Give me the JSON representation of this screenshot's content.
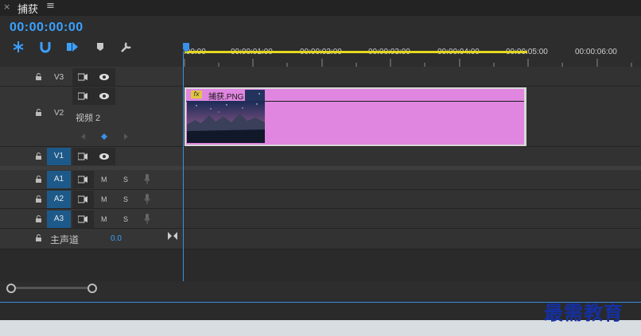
{
  "tab": {
    "close": "×",
    "title": "捕获",
    "menu": "≡"
  },
  "timecode": "00:00:00:00",
  "ruler": {
    "ticks": [
      ":00:00",
      "00:00:01:00",
      "00:00:02:00",
      "00:00:03:00",
      "00:00:04:00",
      "00:00:05:00",
      "00:00:06:00"
    ]
  },
  "tracks": {
    "v3": {
      "label": "V3"
    },
    "v2": {
      "label": "V2",
      "name": "视频 2"
    },
    "v1": {
      "label": "V1"
    },
    "a1": {
      "label": "A1",
      "m": "M",
      "s": "S"
    },
    "a2": {
      "label": "A2",
      "m": "M",
      "s": "S"
    },
    "a3": {
      "label": "A3",
      "m": "M",
      "s": "S"
    },
    "master": {
      "label": "主声道",
      "value": "0.0"
    }
  },
  "clip": {
    "fx": "fx",
    "name": "捕获.PNG",
    "color": "#e086e0"
  },
  "watermark": "最需教育",
  "accent": "#3aa0ff"
}
